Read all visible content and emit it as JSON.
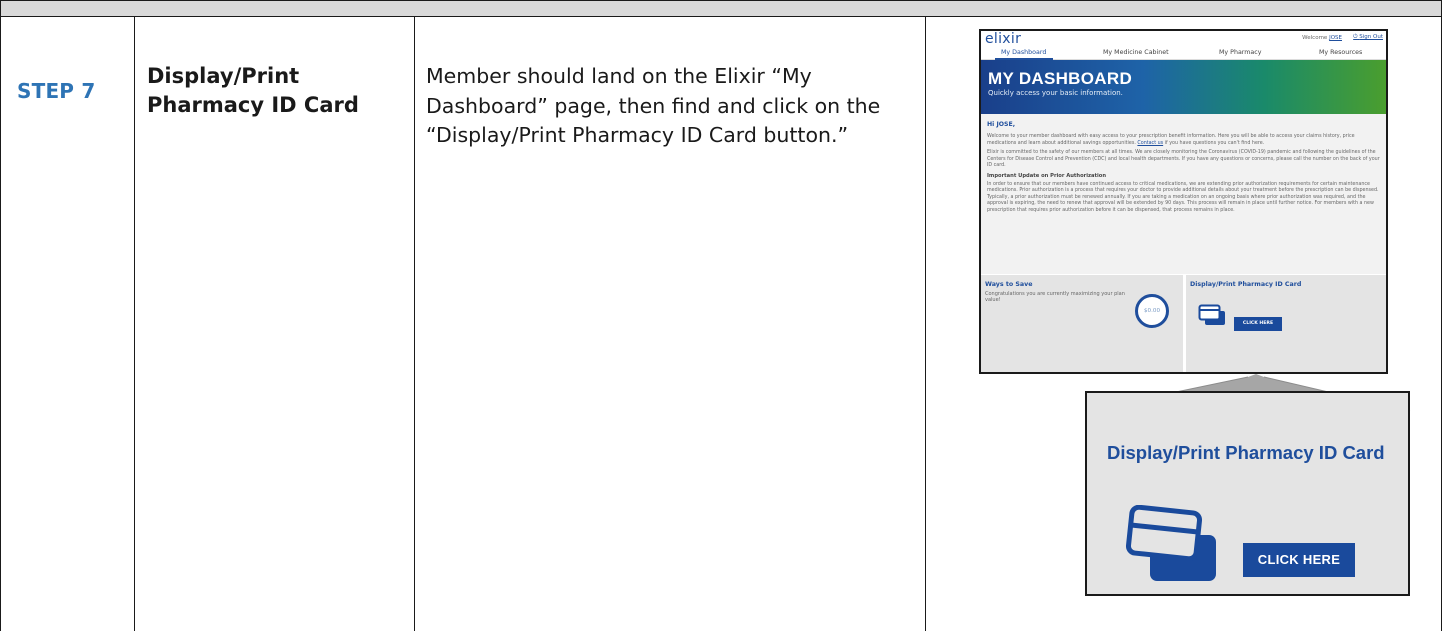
{
  "row": {
    "step": "STEP 7",
    "title_line1": "Display/Print",
    "title_line2": "Pharmacy ID Card",
    "description": "Member should land on the Elixir “My Dashboard” page, then find and click on the “Display/Print Pharmacy ID Card button.”"
  },
  "screenshot": {
    "logo": "elixir",
    "welcome_prefix": "Welcome",
    "welcome_user": "JOSE",
    "sign_out": "Sign Out",
    "nav": [
      "My Dashboard",
      "My Medicine Cabinet",
      "My Pharmacy",
      "My Resources"
    ],
    "hero_title": "MY DASHBOARD",
    "hero_subtitle": "Quickly access your basic information.",
    "greeting": "Hi JOSE,",
    "para1_a": "Welcome to your member dashboard with easy access to your prescription benefit information. Here you will be able to access your claims history, price medications and learn about additional savings opportunities.",
    "para1_link": "Contact us",
    "para1_b": "if you have questions you can't find here.",
    "para2": "Elixir is committed to the safety of our members at all times. We are closely monitoring the Coronavirus (COVID-19) pandemic and following the guidelines of the Centers for Disease Control and Prevention (CDC) and local health departments. If you have any questions or concerns, please call the number on the back of your ID card.",
    "heading": "Important Update on Prior Authorization",
    "para3": "In order to ensure that our members have continued access to critical medications, we are extending prior authorization requirements for certain maintenance medications. Prior authorization is a process that requires your doctor to provide additional details about your treatment before the prescription can be dispensed. Typically, a prior authorization must be renewed annually. If you are taking a medication on an ongoing basis where prior authorization was required, and the approval is expiring, the need to renew that approval will be extended by 90 days. This process will remain in place until further notice. For members with a new prescription that requires prior authorization before it can be dispensed, that process remains in place.",
    "ways_title": "Ways to Save",
    "ways_text": "Congratulations you are currently maximizing your plan value!",
    "gauge_value": "$0.00",
    "id_card_title": "Display/Print Pharmacy ID Card",
    "click_here": "CLICK HERE"
  },
  "zoom": {
    "title": "Display/Print Pharmacy ID Card",
    "button": "CLICK HERE"
  },
  "colors": {
    "step_blue": "#2e74b5",
    "elixir_blue": "#1f4e9c",
    "button_blue": "#1a4a9c",
    "card_gray": "#e4e4e4",
    "header_gray": "#d9d9d9"
  }
}
